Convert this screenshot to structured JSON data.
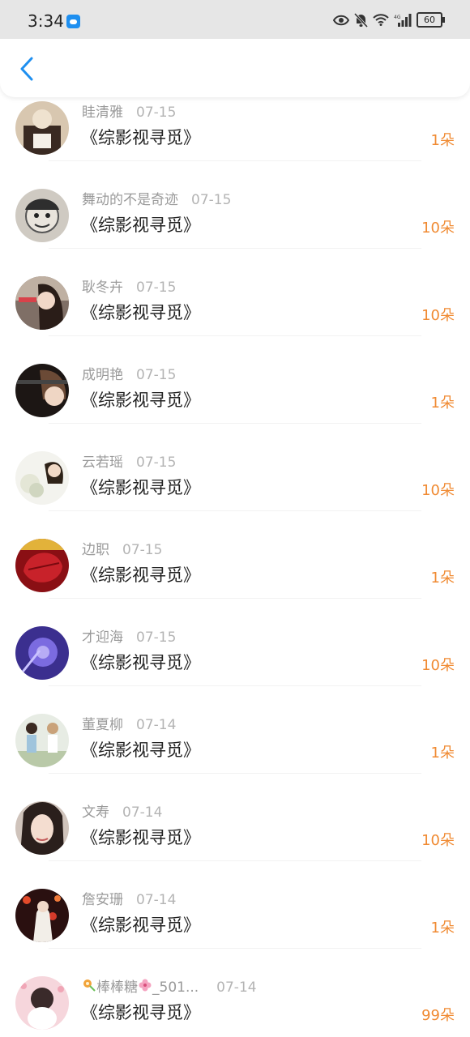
{
  "status_bar": {
    "time": "3:34",
    "battery": "60",
    "network": "4G",
    "icons": [
      "app-badge-icon",
      "eye-icon",
      "bell-off-icon",
      "wifi-icon",
      "signal-icon",
      "battery-icon"
    ]
  },
  "header": {
    "back_icon": "chevron-left-icon",
    "accent_color": "#1e8ff0"
  },
  "gifts": [
    {
      "name": "眭清雅",
      "date": "07-15",
      "book": "《综影视寻觅》",
      "amount": "1朵"
    },
    {
      "name": "舞动的不是奇迹",
      "date": "07-15",
      "book": "《综影视寻觅》",
      "amount": "10朵"
    },
    {
      "name": "耿冬卉",
      "date": "07-15",
      "book": "《综影视寻觅》",
      "amount": "10朵"
    },
    {
      "name": "成明艳",
      "date": "07-15",
      "book": "《综影视寻觅》",
      "amount": "1朵"
    },
    {
      "name": "云若瑶",
      "date": "07-15",
      "book": "《综影视寻觅》",
      "amount": "10朵"
    },
    {
      "name": "边职",
      "date": "07-15",
      "book": "《综影视寻觅》",
      "amount": "1朵"
    },
    {
      "name": "才迎海",
      "date": "07-15",
      "book": "《综影视寻觅》",
      "amount": "10朵"
    },
    {
      "name": "董夏柳",
      "date": "07-14",
      "book": "《综影视寻觅》",
      "amount": "1朵"
    },
    {
      "name": "文寿",
      "date": "07-14",
      "book": "《综影视寻觅》",
      "amount": "10朵"
    },
    {
      "name": "詹安珊",
      "date": "07-14",
      "book": "《综影视寻觅》",
      "amount": "1朵"
    },
    {
      "name": "棒棒糖",
      "name_suffix": "_501...",
      "date": "07-14",
      "book": "《综影视寻觅》",
      "amount": "99朵"
    }
  ],
  "colors": {
    "amount": "#f08a32",
    "name": "#9a9a9a",
    "title": "#222222"
  }
}
